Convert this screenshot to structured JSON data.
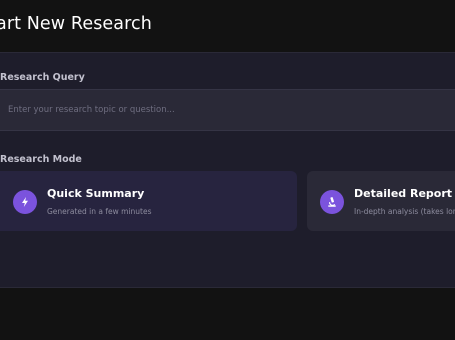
{
  "header": {
    "title": "art New Research"
  },
  "form": {
    "query_label": "Research Query",
    "query_placeholder": "Enter your research topic or question...",
    "query_value": "",
    "mode_label": "Research Mode",
    "modes": [
      {
        "title": "Quick Summary",
        "description": "Generated in a few minutes",
        "icon": "lightning-icon",
        "selected": true
      },
      {
        "title": "Detailed Report",
        "description": "In-depth analysis (takes lon",
        "icon": "microscope-icon",
        "selected": false
      }
    ]
  },
  "colors": {
    "background": "#121212",
    "panel": "#1e1d2b",
    "input": "#2a2937",
    "selected_card": "#27243f",
    "accent": "#7b53dd"
  }
}
